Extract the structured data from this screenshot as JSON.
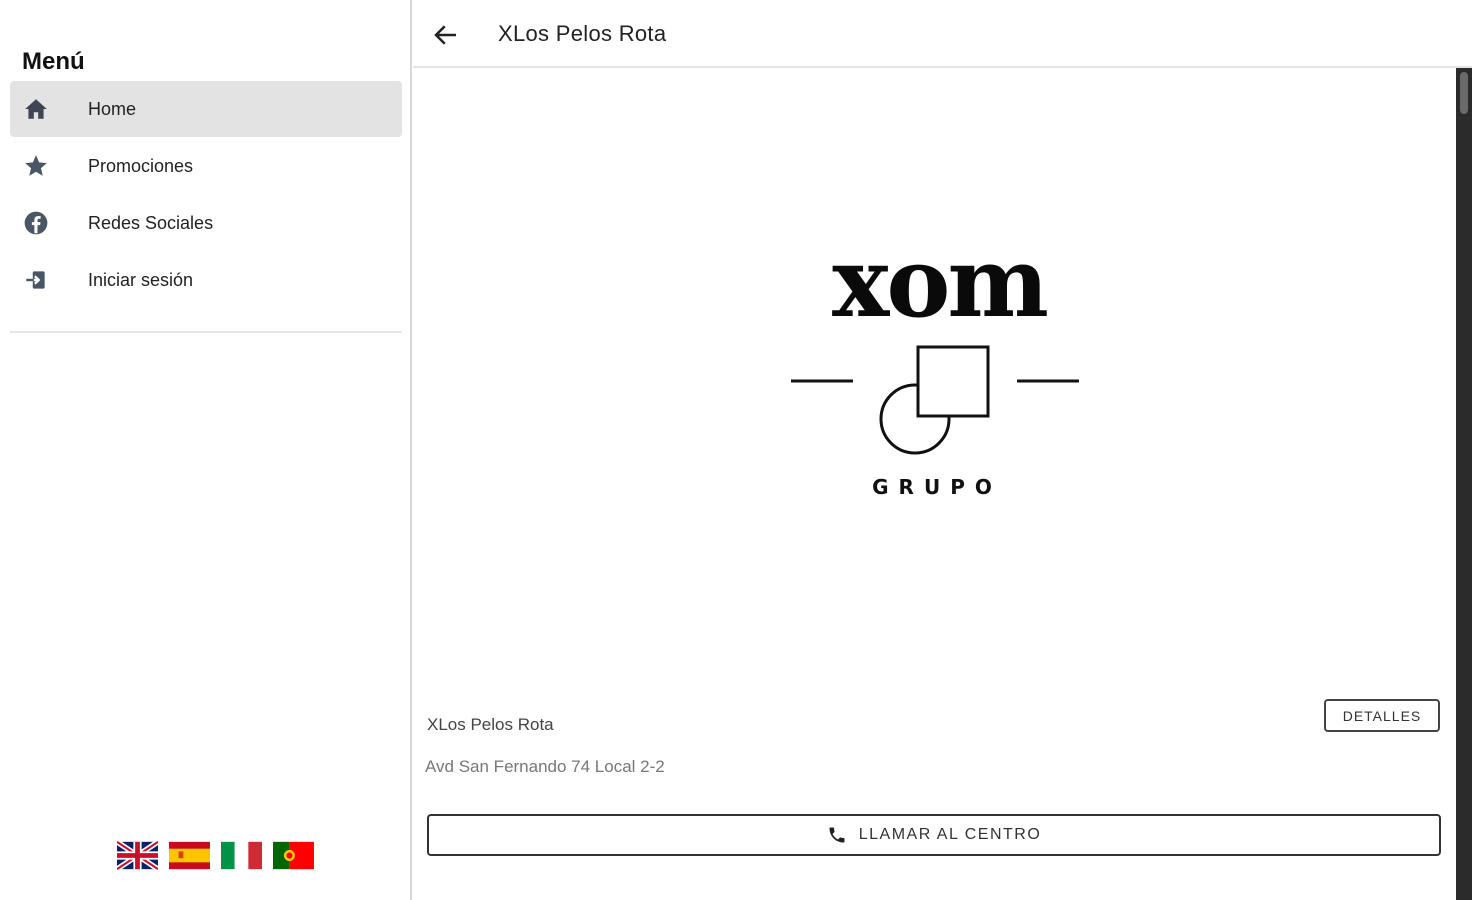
{
  "sidebar": {
    "title": "Menú",
    "items": [
      {
        "label": "Home",
        "icon": "home-icon",
        "active": true
      },
      {
        "label": "Promociones",
        "icon": "star-icon",
        "active": false
      },
      {
        "label": "Redes Sociales",
        "icon": "facebook-icon",
        "active": false
      },
      {
        "label": "Iniciar sesión",
        "icon": "login-icon",
        "active": false
      }
    ],
    "languages": [
      "flag-uk-icon",
      "flag-spain-icon",
      "flag-italy-icon",
      "flag-portugal-icon"
    ]
  },
  "header": {
    "title": "XLos Pelos Rota",
    "back_icon": "arrow-left-icon"
  },
  "logo": {
    "wordmark": "xom",
    "subtitle": "GRUPO"
  },
  "venue": {
    "name": "XLos Pelos Rota",
    "address": "Avd San Fernando 74 Local 2-2",
    "details_label": "DETALLES",
    "call_label": "LLAMAR AL CENTRO",
    "call_icon": "phone-icon"
  },
  "colors": {
    "active_bg": "#e3e3e3",
    "icon_color": "#4a5566",
    "scrollbar": "#2b2b2b"
  }
}
